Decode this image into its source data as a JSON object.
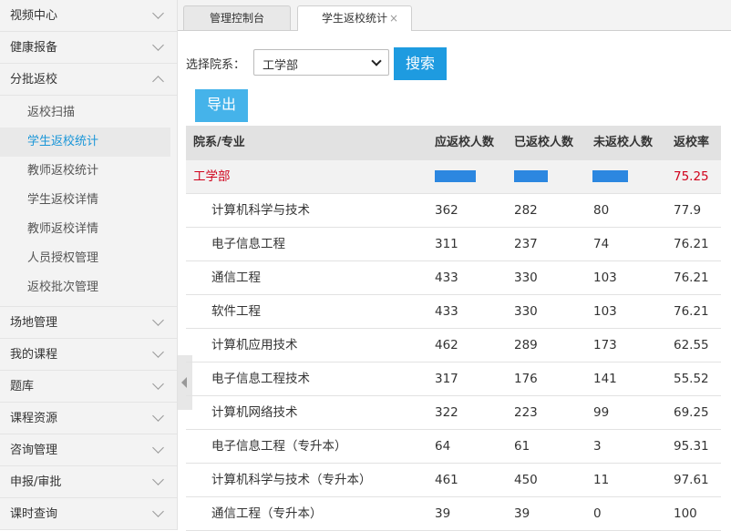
{
  "sidebar": {
    "items": [
      {
        "label": "视频中心",
        "expanded": false
      },
      {
        "label": "健康报备",
        "expanded": false
      },
      {
        "label": "分批返校",
        "expanded": true
      },
      {
        "label": "场地管理",
        "expanded": false
      },
      {
        "label": "我的课程",
        "expanded": false
      },
      {
        "label": "题库",
        "expanded": false
      },
      {
        "label": "课程资源",
        "expanded": false
      },
      {
        "label": "咨询管理",
        "expanded": false
      },
      {
        "label": "申报/审批",
        "expanded": false
      },
      {
        "label": "课时查询",
        "expanded": false
      }
    ],
    "submenu": [
      "返校扫描",
      "学生返校统计",
      "教师返校统计",
      "学生返校详情",
      "教师返校详情",
      "人员授权管理",
      "返校批次管理"
    ],
    "active_sub": "学生返校统计"
  },
  "tabs": [
    {
      "label": "管理控制台",
      "active": false
    },
    {
      "label": "学生返校统计",
      "active": true,
      "close": "×"
    }
  ],
  "filter": {
    "label": "选择院系：",
    "selected": "工学部",
    "search_label": "搜索",
    "export_label": "导出"
  },
  "colors": {
    "accent": "#1e9be0",
    "dept_text": "#d0021b",
    "bar": "#2c87e0"
  },
  "table": {
    "headers": [
      "院系/专业",
      "应返校人数",
      "已返校人数",
      "未返校人数",
      "返校率"
    ],
    "dept": {
      "name": "工学部",
      "rate": "75.25"
    },
    "rows": [
      [
        "计算机科学与技术",
        "362",
        "282",
        "80",
        "77.9"
      ],
      [
        "电子信息工程",
        "311",
        "237",
        "74",
        "76.21"
      ],
      [
        "通信工程",
        "433",
        "330",
        "103",
        "76.21"
      ],
      [
        "软件工程",
        "433",
        "330",
        "103",
        "76.21"
      ],
      [
        "计算机应用技术",
        "462",
        "289",
        "173",
        "62.55"
      ],
      [
        "电子信息工程技术",
        "317",
        "176",
        "141",
        "55.52"
      ],
      [
        "计算机网络技术",
        "322",
        "223",
        "99",
        "69.25"
      ],
      [
        "电子信息工程（专升本）",
        "64",
        "61",
        "3",
        "95.31"
      ],
      [
        "计算机科学与技术（专升本）",
        "461",
        "450",
        "11",
        "97.61"
      ],
      [
        "通信工程（专升本）",
        "39",
        "39",
        "0",
        "100"
      ]
    ]
  }
}
